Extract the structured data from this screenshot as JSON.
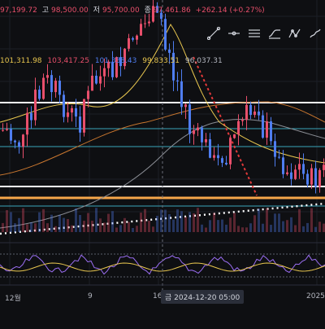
{
  "ohlc": {
    "open_label": "",
    "open": "97,199.72",
    "high_label": "고",
    "high": "98,500.00",
    "low_label": "저",
    "low": "95,700.00",
    "close_label": "종",
    "close": "97,461.86",
    "change": "+262.14 (+0.27%)"
  },
  "moving_averages": [
    "101,311.98",
    "103,417.25",
    "101,338.43",
    "99,833.51",
    "96,037.31"
  ],
  "colors": {
    "background": "#0e0f12",
    "up": "#e84f6b",
    "down": "#4f7df0",
    "ma_fast": "#2fd0e8",
    "ma_mid": "#e8c64f",
    "ma_slow": "#c8762f",
    "ma_long": "#8a8d94",
    "support": "#f5a64a",
    "resistance": "#ffffff",
    "trend_red": "#e23a3a"
  },
  "toolbar_icons": [
    "line-tool-icon",
    "horizontal-line-icon",
    "parallel-channel-icon",
    "fib-retracement-icon",
    "pattern-icon",
    "brush-icon"
  ],
  "x_axis": {
    "labels": [
      "12월",
      "9",
      "16",
      "2025"
    ],
    "crosshair_date": "금 2024-12-20   05:00"
  }
}
